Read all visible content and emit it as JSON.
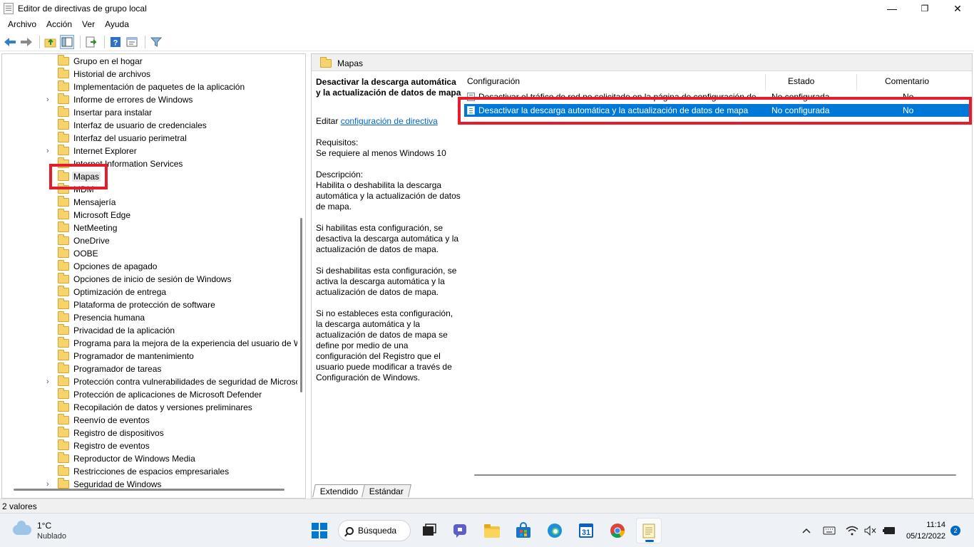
{
  "window": {
    "title": "Editor de directivas de grupo local",
    "minimize": "—",
    "maximize": "❐",
    "close": "✕"
  },
  "menu": [
    "Archivo",
    "Acción",
    "Ver",
    "Ayuda"
  ],
  "tree": {
    "items": [
      {
        "label": "Grupo en el hogar",
        "expandable": false
      },
      {
        "label": "Historial de archivos",
        "expandable": false
      },
      {
        "label": "Implementación de paquetes de la aplicación",
        "expandable": false
      },
      {
        "label": "Informe de errores de Windows",
        "expandable": true
      },
      {
        "label": "Insertar para instalar",
        "expandable": false
      },
      {
        "label": "Interfaz de usuario de credenciales",
        "expandable": false
      },
      {
        "label": "Interfaz del usuario perimetral",
        "expandable": false
      },
      {
        "label": "Internet Explorer",
        "expandable": true
      },
      {
        "label": "Internet Information Services",
        "expandable": false
      },
      {
        "label": "Mapas",
        "expandable": false,
        "selected": true
      },
      {
        "label": "MDM",
        "expandable": false
      },
      {
        "label": "Mensajería",
        "expandable": false
      },
      {
        "label": "Microsoft Edge",
        "expandable": false
      },
      {
        "label": "NetMeeting",
        "expandable": false
      },
      {
        "label": "OneDrive",
        "expandable": false
      },
      {
        "label": "OOBE",
        "expandable": false
      },
      {
        "label": "Opciones de apagado",
        "expandable": false
      },
      {
        "label": "Opciones de inicio de sesión de Windows",
        "expandable": false
      },
      {
        "label": "Optimización de entrega",
        "expandable": false
      },
      {
        "label": "Plataforma de protección de software",
        "expandable": false
      },
      {
        "label": "Presencia humana",
        "expandable": false
      },
      {
        "label": "Privacidad de la aplicación",
        "expandable": false
      },
      {
        "label": "Programa para la mejora de la experiencia del usuario de W",
        "expandable": false
      },
      {
        "label": "Programador de mantenimiento",
        "expandable": false
      },
      {
        "label": "Programador de tareas",
        "expandable": false
      },
      {
        "label": "Protección contra vulnerabilidades de seguridad de Microso",
        "expandable": true
      },
      {
        "label": "Protección de aplicaciones de Microsoft Defender",
        "expandable": false
      },
      {
        "label": "Recopilación de datos y versiones preliminares",
        "expandable": false
      },
      {
        "label": "Reenvío de eventos",
        "expandable": false
      },
      {
        "label": "Registro de dispositivos",
        "expandable": false
      },
      {
        "label": "Registro de eventos",
        "expandable": false
      },
      {
        "label": "Reproductor de Windows Media",
        "expandable": false
      },
      {
        "label": "Restricciones de espacios empresariales",
        "expandable": false
      },
      {
        "label": "Seguridad de Windows",
        "expandable": true
      }
    ]
  },
  "right": {
    "header_title": "Mapas",
    "description": {
      "title": "Desactivar la descarga automática y la actualización de datos de mapa",
      "edit_prefix": "Editar",
      "edit_link": "configuración de directiva",
      "req_label": "Requisitos:",
      "req_text": "Se requiere al menos Windows 10",
      "desc_label": "Descripción:",
      "desc_text": "Habilita o deshabilita la descarga automática y la actualización de datos de mapa.",
      "p1": "Si habilitas esta configuración, se desactiva la descarga automática y la actualización de datos de mapa.",
      "p2": "Si deshabilitas esta configuración, se activa la descarga automática y la actualización de datos de mapa.",
      "p3": "Si no estableces esta configuración, la descarga automática y la actualización de datos de mapa se define por medio de una configuración del Registro que el usuario puede modificar a través de Configuración de Windows."
    },
    "columns": {
      "setting": "Configuración",
      "state": "Estado",
      "comment": "Comentario"
    },
    "rows": [
      {
        "setting": "Desactivar el tráfico de red no solicitado en la página de configuración de…",
        "state": "No configurada",
        "comment": "No"
      },
      {
        "setting": "Desactivar la descarga automática y la actualización de datos de mapa",
        "state": "No configurada",
        "comment": "No"
      }
    ]
  },
  "tabs": {
    "extended": "Extendido",
    "standard": "Estándar"
  },
  "status": {
    "text": "2 valores"
  },
  "taskbar": {
    "weather_temp": "1°C",
    "weather_cond": "Nublado",
    "search_label": "Búsqueda",
    "calendar_day": "31",
    "time": "11:14",
    "date": "05/12/2022",
    "notifications": "2"
  },
  "colors": {
    "selection": "#0078d7",
    "highlight_box": "#e41c2b",
    "taskbar_accent": "#0067c0"
  }
}
